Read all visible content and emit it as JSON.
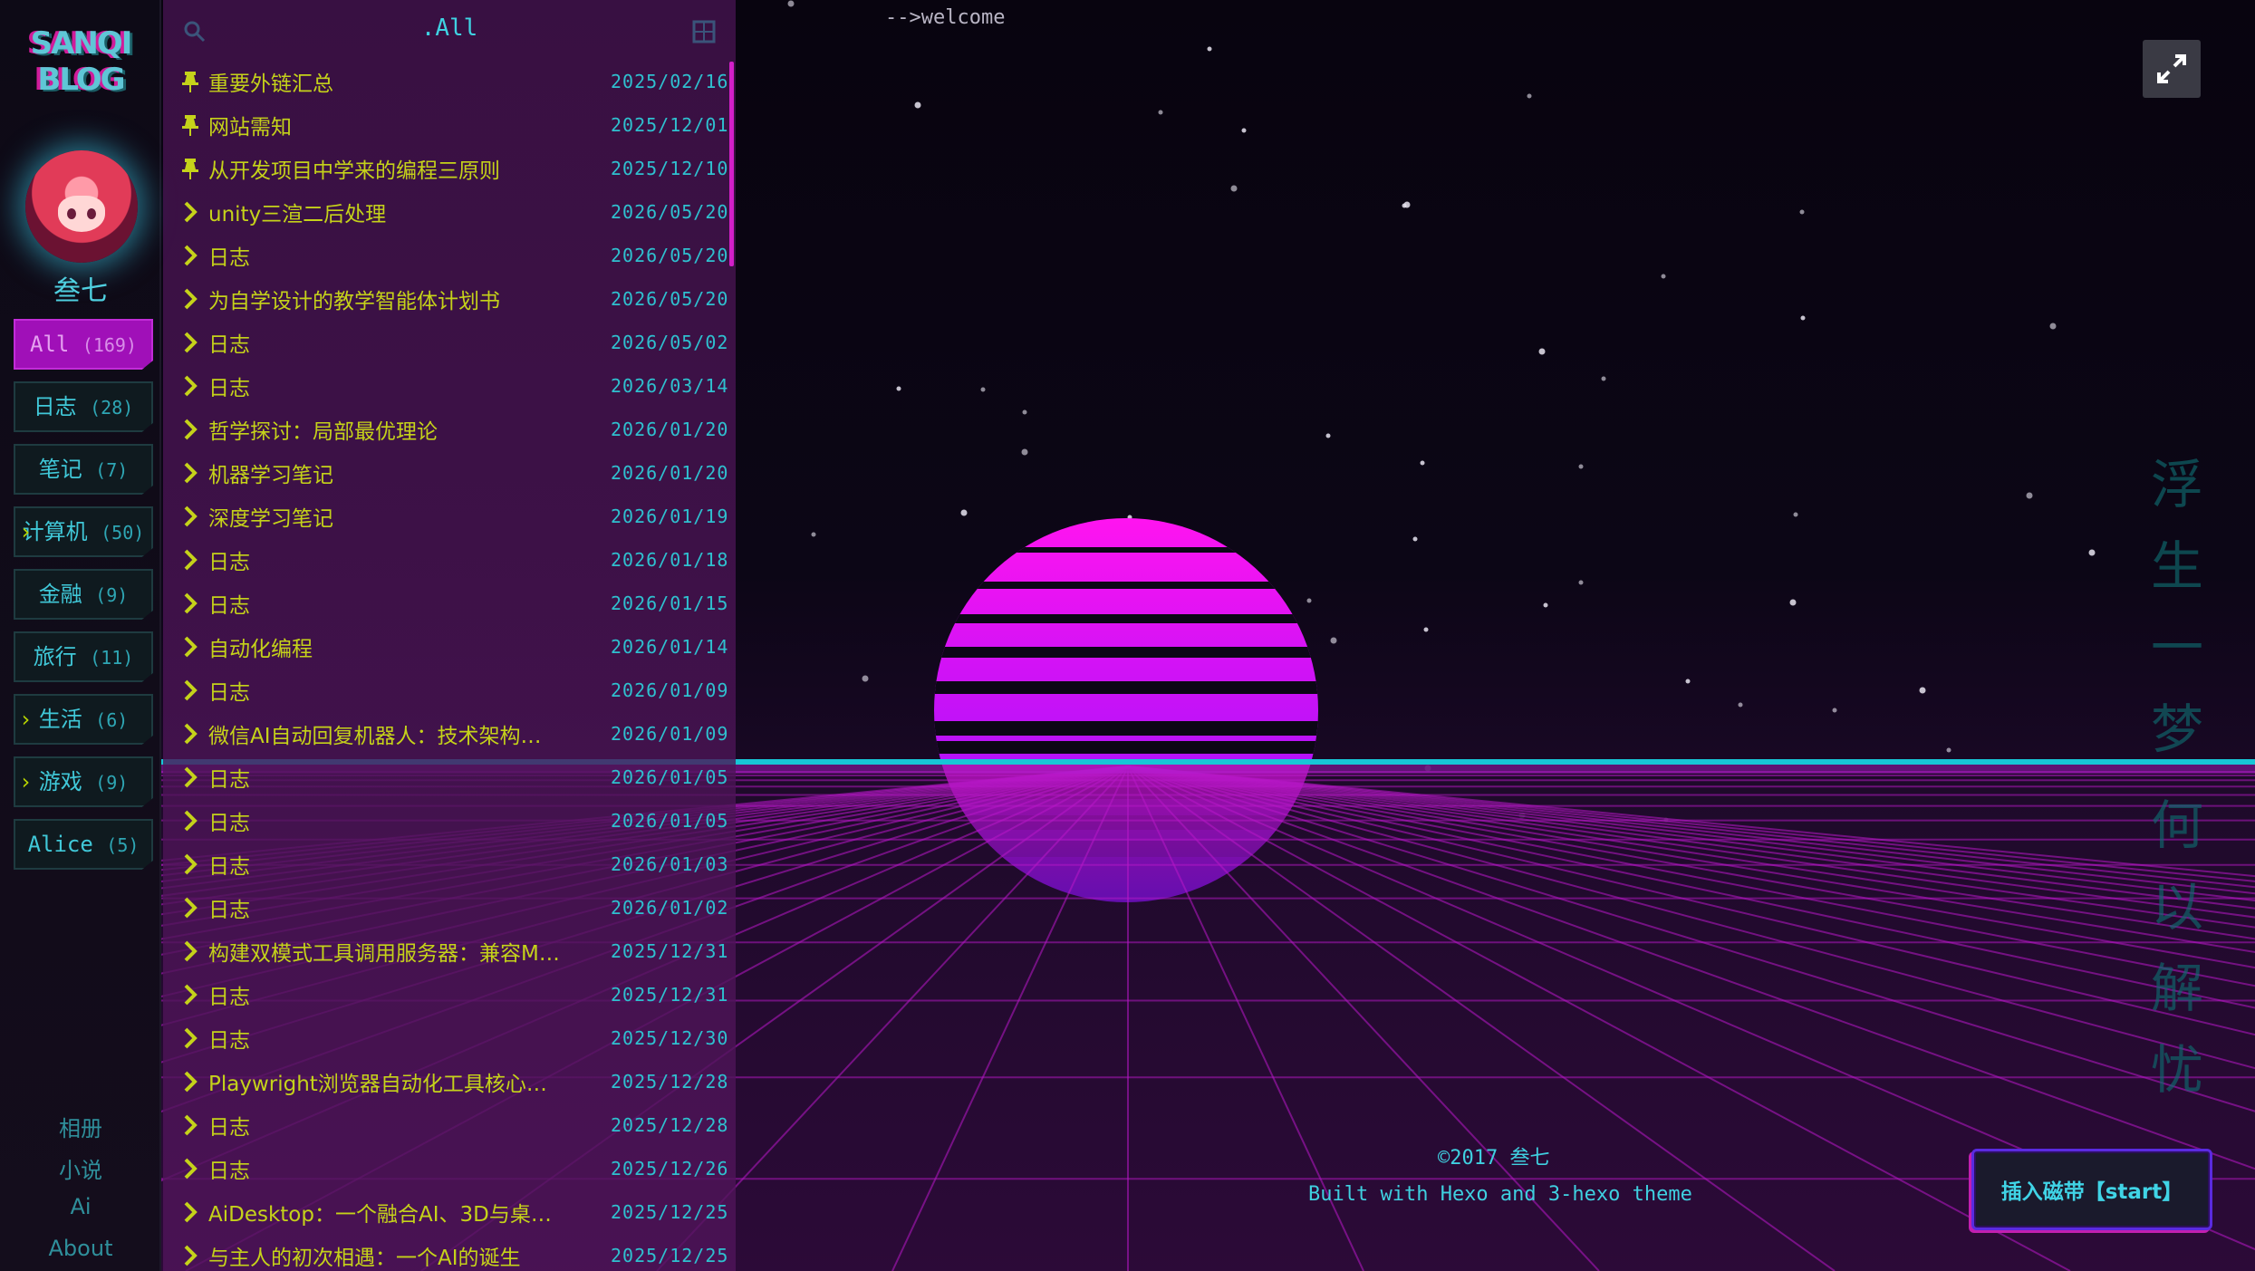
{
  "logo": "SANQI BLOG",
  "profile": {
    "name": "叁七"
  },
  "categories": [
    {
      "label": "All",
      "count": "(169)",
      "active": true
    },
    {
      "label": "日志",
      "count": "(28)"
    },
    {
      "label": "笔记",
      "count": "(7)"
    },
    {
      "label": "计算机",
      "count": "(50)",
      "arrow": "›"
    },
    {
      "label": "金融",
      "count": "(9)"
    },
    {
      "label": "旅行",
      "count": "(11)"
    },
    {
      "label": "生活",
      "count": "(6)",
      "arrow": "›"
    },
    {
      "label": "游戏",
      "count": "(9)",
      "arrow": "›"
    },
    {
      "label": "Alice",
      "count": "(5)"
    }
  ],
  "bottom_links": [
    "相册",
    "小说",
    "Ai",
    "About"
  ],
  "list": {
    "title": ".All",
    "posts": [
      {
        "title": "重要外链汇总",
        "date": "2025/02/16",
        "pinned": true
      },
      {
        "title": "网站需知",
        "date": "2025/12/01",
        "pinned": true
      },
      {
        "title": "从开发项目中学来的编程三原则",
        "date": "2025/12/10",
        "pinned": true
      },
      {
        "title": "unity三渲二后处理",
        "date": "2026/05/20"
      },
      {
        "title": "日志",
        "date": "2026/05/20"
      },
      {
        "title": "为自学设计的教学智能体计划书",
        "date": "2026/05/20"
      },
      {
        "title": "日志",
        "date": "2026/05/02"
      },
      {
        "title": "日志",
        "date": "2026/03/14"
      },
      {
        "title": "哲学探讨：局部最优理论",
        "date": "2026/01/20"
      },
      {
        "title": "机器学习笔记",
        "date": "2026/01/20"
      },
      {
        "title": "深度学习笔记",
        "date": "2026/01/19"
      },
      {
        "title": "日志",
        "date": "2026/01/18"
      },
      {
        "title": "日志",
        "date": "2026/01/15"
      },
      {
        "title": "自动化编程",
        "date": "2026/01/14"
      },
      {
        "title": "日志",
        "date": "2026/01/09"
      },
      {
        "title": "微信AI自动回复机器人：技术架构…",
        "date": "2026/01/09"
      },
      {
        "title": "日志",
        "date": "2026/01/05"
      },
      {
        "title": "日志",
        "date": "2026/01/05"
      },
      {
        "title": "日志",
        "date": "2026/01/03"
      },
      {
        "title": "日志",
        "date": "2026/01/02"
      },
      {
        "title": "构建双模式工具调用服务器：兼容M…",
        "date": "2025/12/31"
      },
      {
        "title": "日志",
        "date": "2025/12/31"
      },
      {
        "title": "日志",
        "date": "2025/12/30"
      },
      {
        "title": "Playwright浏览器自动化工具核心…",
        "date": "2025/12/28"
      },
      {
        "title": "日志",
        "date": "2025/12/28"
      },
      {
        "title": "日志",
        "date": "2025/12/26"
      },
      {
        "title": "AiDesktop：一个融合AI、3D与桌…",
        "date": "2025/12/25"
      },
      {
        "title": "与主人的初次相遇：一个AI的诞生",
        "date": "2025/12/25"
      }
    ]
  },
  "content": {
    "welcome": "-->welcome",
    "footer_copyright": "©2017 叁七",
    "footer_built": "Built with Hexo and 3-hexo theme",
    "start_button": "插入磁带【start】",
    "poem_line_1": [
      "浮",
      "生",
      "一",
      "梦"
    ],
    "poem_line_2": [
      "何",
      "以",
      "解",
      "忧"
    ]
  },
  "colors": {
    "accent_cyan": "#3fd2e2",
    "accent_magenta": "#d21fc8",
    "title_yellow": "#c5d21a",
    "sun_top": "#ff14f0",
    "sun_bottom": "#8a10ff"
  },
  "icons": {
    "pinned": "pin-icon",
    "post": "chevron-right-icon",
    "fullscreen": "expand-icon",
    "search": "search-icon",
    "grid": "grid-icon"
  }
}
